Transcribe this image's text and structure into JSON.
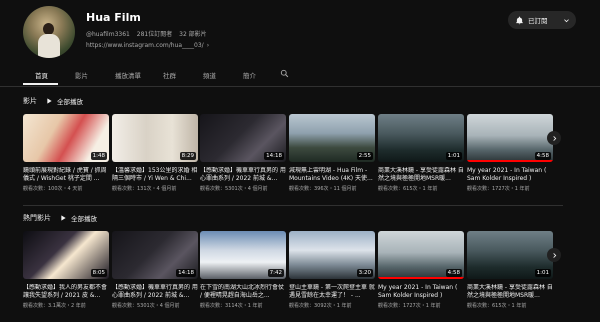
{
  "channel": {
    "name": "Hua Film",
    "handle": "@huafilm3361",
    "subscribers": "281位訂閱者",
    "video_count": "32 部影片",
    "link": "https://www.instagram.com/hua____03/",
    "subscribe_label": "已訂閱"
  },
  "tabs": [
    "首頁",
    "影片",
    "播放清單",
    "社群",
    "頻道",
    "簡介"
  ],
  "shelves": [
    {
      "title": "影片",
      "play_all": "全部播放",
      "videos": [
        {
          "title": "鏡頭前展現對紀錄 / 虎寶 / 抓周儀式 / WishGet 桃子定間 ...",
          "meta": "觀看次數：100次・4 天前",
          "duration": "1:48",
          "art": "art-1",
          "progress": 0
        },
        {
          "title": "【溫馨求婚】153公里的求婚 相隔三個時市 / Yi Wen & Chi...",
          "meta": "觀看次數：131次・4 個月前",
          "duration": "8:29",
          "art": "art-2",
          "progress": 0
        },
        {
          "title": "【感動求婚】機車車行真男的 用心罪曲系列 / 2022 前城 &...",
          "meta": "觀看次數：5301次・4 個月前",
          "duration": "14:18",
          "art": "art-3",
          "progress": 0
        },
        {
          "title": "減現無上雲明湖 - Hua Film - Mountains Video (4K) 天使...",
          "meta": "觀看次數：396次・11 個月前",
          "duration": "2:55",
          "art": "art-4",
          "progress": 0
        },
        {
          "title": "商業大溪林鏡 - 享受徒露森林 自然之境與極極開地MSR暖...",
          "meta": "觀看次數：615次・1 年前",
          "duration": "1:01",
          "art": "art-5",
          "progress": 0
        },
        {
          "title": "My year 2021 - In Taiwan ( Sam Kolder Inspired )",
          "meta": "觀看次數：1727次・1 年前",
          "duration": "4:58",
          "art": "art-6",
          "progress": 1.0
        }
      ]
    },
    {
      "title": "熱門影片",
      "play_all": "全部播放",
      "videos": [
        {
          "title": "【感動求婚】我人的男友都不會讓我失望系列 / 2021 皮 &...",
          "meta": "觀看次數：3.1萬次・2 年前",
          "duration": "8:05",
          "art": "art-7",
          "progress": 0
        },
        {
          "title": "【感動求婚】機車車行真男的 用心罪曲系列 / 2022 前城 &...",
          "meta": "觀看次數：5301次・4 個月前",
          "duration": "14:18",
          "art": "art-3",
          "progress": 0
        },
        {
          "title": "在下雪的南湖大山北冰烈行會仗 / 便裡晴晃趕自海山岳之...",
          "meta": "觀看次數：3114次・1 年前",
          "duration": "7:42",
          "art": "art-8",
          "progress": 0
        },
        {
          "title": "登山主車鏡 - 第一次爬登主車 就遇見雪餘在太幸運了！ - ...",
          "meta": "觀看次數：3092次・1 年前",
          "duration": "3:20",
          "art": "art-9",
          "progress": 0
        },
        {
          "title": "My year 2021 - In Taiwan ( Sam Kolder Inspired )",
          "meta": "觀看次數：1727次・1 年前",
          "duration": "4:58",
          "art": "art-6",
          "progress": 1.0
        },
        {
          "title": "商業大溪林鏡 - 享受徒露森林 自然之境與極極開地MSR暖...",
          "meta": "觀看次數：615次・1 年前",
          "duration": "1:01",
          "art": "art-5",
          "progress": 0
        }
      ]
    }
  ],
  "icons": {
    "bell": "bell-icon",
    "caret": "chevron-down-icon",
    "search": "search-icon",
    "play_all": "play-icon",
    "next": "chevron-right-icon"
  },
  "colors": {
    "background": "#0f0f0f",
    "progress": "#ff0000"
  }
}
